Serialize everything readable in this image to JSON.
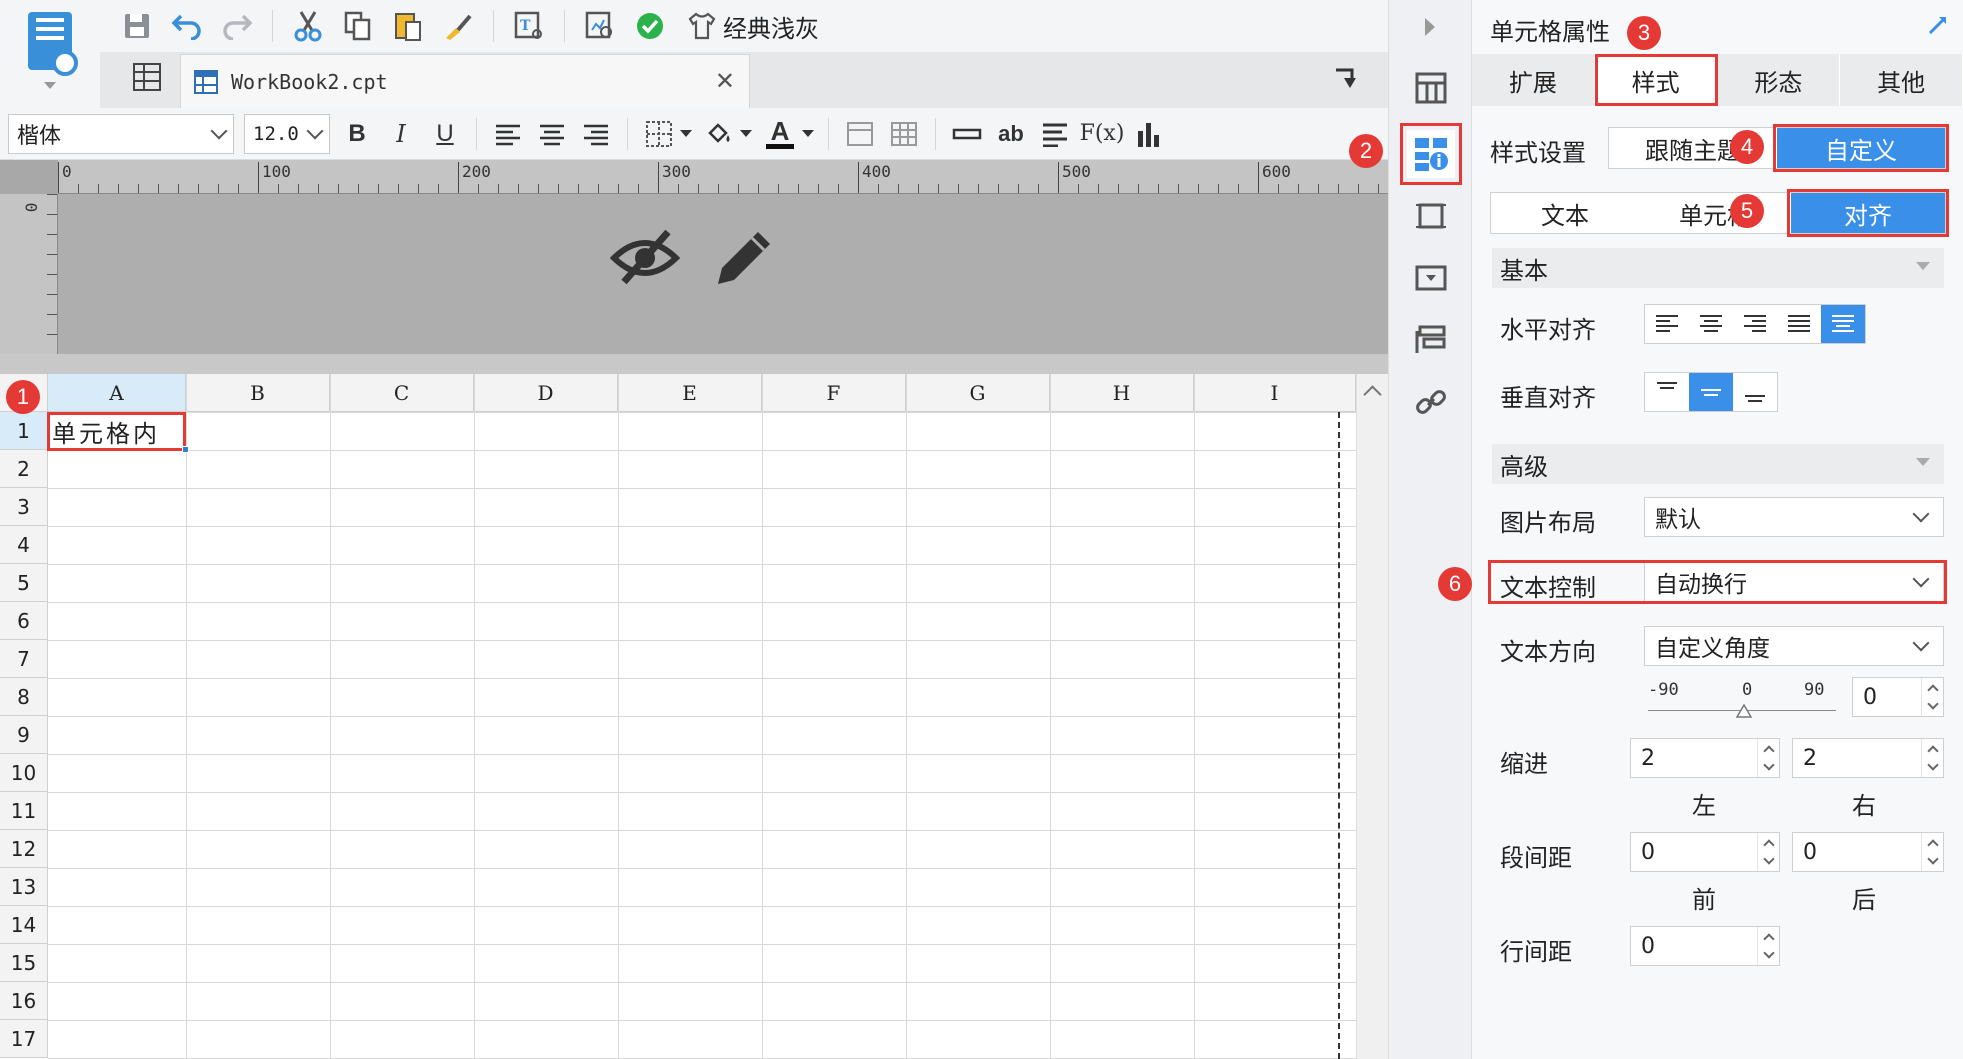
{
  "toolbar": {
    "theme_label": "经典浅灰"
  },
  "tabs": {
    "workbook_name": "WorkBook2.cpt"
  },
  "format_bar": {
    "font_name": "楷体",
    "font_size": "12.0",
    "bold": "B",
    "italic": "I",
    "underline": "U",
    "text_color_label": "A",
    "wrap_label": "ab",
    "formula_label": "F(x)"
  },
  "ruler": {
    "marks": [
      "0",
      "100",
      "200",
      "300",
      "400",
      "500",
      "600"
    ],
    "vertical_mark": "0"
  },
  "grid": {
    "columns": [
      "A",
      "B",
      "C",
      "D",
      "E",
      "F",
      "G",
      "H",
      "I"
    ],
    "rows": [
      "1",
      "2",
      "3",
      "4",
      "5",
      "6",
      "7",
      "8",
      "9",
      "10",
      "11",
      "12",
      "13",
      "14",
      "15",
      "16",
      "17"
    ],
    "cell_a1": "单元格内"
  },
  "panel": {
    "title": "单元格属性",
    "tabs": [
      "扩展",
      "样式",
      "形态",
      "其他"
    ],
    "style_setting_label": "样式设置",
    "style_options": [
      "跟随主题",
      "自定义"
    ],
    "sub_tabs": [
      "文本",
      "单元格",
      "对齐"
    ],
    "basic_section": "基本",
    "h_align_label": "水平对齐",
    "v_align_label": "垂直对齐",
    "advanced_section": "高级",
    "image_layout_label": "图片布局",
    "image_layout_value": "默认",
    "text_control_label": "文本控制",
    "text_control_value": "自动换行",
    "text_direction_label": "文本方向",
    "text_direction_value": "自定义角度",
    "slider_min": "-90",
    "slider_mid": "0",
    "slider_max": "90",
    "angle_value": "0",
    "indent_label": "缩进",
    "indent_left": "2",
    "indent_right": "2",
    "left_label": "左",
    "right_label": "右",
    "para_spacing_label": "段间距",
    "para_before": "0",
    "para_after": "0",
    "before_label": "前",
    "after_label": "后",
    "line_spacing_label": "行间距",
    "line_spacing_value": "0"
  },
  "badges": [
    "1",
    "2",
    "3",
    "4",
    "5",
    "6"
  ],
  "colors": {
    "accent_blue": "#3a8fe8",
    "highlight_red": "#e53935",
    "selected_header": "#d7ecf8"
  }
}
